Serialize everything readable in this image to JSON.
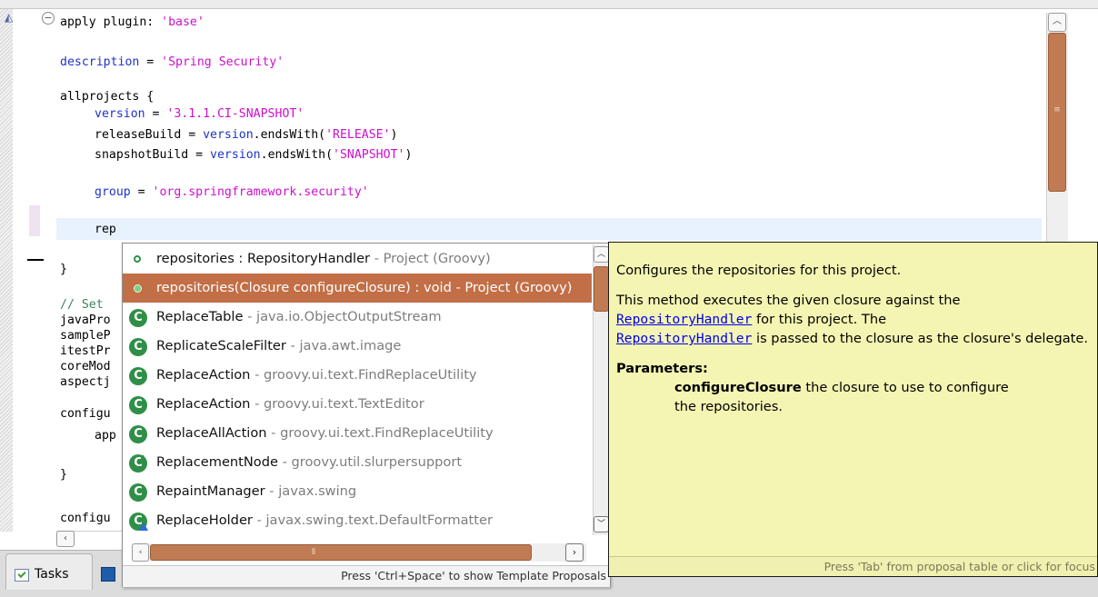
{
  "editor": {
    "code_lines": [
      {
        "id": "l1",
        "text": "apply plugin: 'base'"
      },
      {
        "id": "l2",
        "text": "description = 'Spring Security'"
      },
      {
        "id": "l3",
        "text": "allprojects {"
      },
      {
        "id": "l4",
        "text": "    version = '3.1.1.CI-SNAPSHOT'"
      },
      {
        "id": "l5",
        "text": "    releaseBuild = version.endsWith('RELEASE')"
      },
      {
        "id": "l6",
        "text": "    snapshotBuild = version.endsWith('SNAPSHOT')"
      },
      {
        "id": "l7",
        "text": "    group = 'org.springframework.security'"
      },
      {
        "id": "l8",
        "text": "    rep"
      },
      {
        "id": "l9",
        "text": "}"
      },
      {
        "id": "l10",
        "text": "// Set"
      },
      {
        "id": "l11",
        "text": "javaPro"
      },
      {
        "id": "l12",
        "text": "sampleP"
      },
      {
        "id": "l13",
        "text": "itestPr"
      },
      {
        "id": "l14",
        "text": "coreMod"
      },
      {
        "id": "l15",
        "text": "aspectj"
      },
      {
        "id": "l16",
        "text": "configu"
      },
      {
        "id": "l17",
        "text": "    app"
      },
      {
        "id": "l18",
        "text": "}"
      },
      {
        "id": "l19",
        "text": "configu"
      }
    ],
    "tokens": {
      "apply": "apply plugin: ",
      "apply_str": "'base'",
      "description_kw": "description",
      "description_eq": " = ",
      "description_str": "'Spring Security'",
      "allprojects": "allprojects {",
      "version_kw": "version",
      "version_str": "'3.1.1.CI-SNAPSHOT'",
      "release_prefix": "releaseBuild = ",
      "release_method": ".endsWith(",
      "release_str": "'RELEASE'",
      "snapshot_prefix": "snapshotBuild = ",
      "snapshot_str": "'SNAPSHOT'",
      "group_kw": "group",
      "group_str": "'org.springframework.security'",
      "rep": "rep",
      "close_brace": "}",
      "comment": "// Set",
      "javaPro": "javaPro",
      "sampleP": "sampleP",
      "itestPr": "itestPr",
      "coreMod": "coreMod",
      "aspectj": "aspectj",
      "configu": "configu",
      "app": "app",
      "configu2": "configu"
    }
  },
  "proposals": {
    "items": [
      {
        "name": "repositories : RepositoryHandler",
        "detail": " - Project (Groovy)",
        "icon": "field-icon",
        "selected": false
      },
      {
        "name": "repositories(Closure configureClosure) : void",
        "detail": " - Project (Groovy)",
        "icon": "method-icon",
        "selected": true
      },
      {
        "name": "ReplaceTable",
        "detail": " - java.io.ObjectOutputStream",
        "icon": "class-icon",
        "selected": false
      },
      {
        "name": "ReplicateScaleFilter",
        "detail": " - java.awt.image",
        "icon": "class-icon",
        "selected": false
      },
      {
        "name": "ReplaceAction",
        "detail": " - groovy.ui.text.FindReplaceUtility",
        "icon": "class-icon",
        "selected": false
      },
      {
        "name": "ReplaceAction",
        "detail": " - groovy.ui.text.TextEditor",
        "icon": "class-icon",
        "selected": false
      },
      {
        "name": "ReplaceAllAction",
        "detail": " - groovy.ui.text.FindReplaceUtility",
        "icon": "class-icon",
        "selected": false
      },
      {
        "name": "ReplacementNode",
        "detail": " - groovy.util.slurpersupport",
        "icon": "abstract-class-icon",
        "selected": false
      },
      {
        "name": "RepaintManager",
        "detail": " - javax.swing",
        "icon": "class-icon",
        "selected": false
      },
      {
        "name": "ReplaceHolder",
        "detail": " - javax.swing.text.DefaultFormatter",
        "icon": "class-icon",
        "selected": false
      }
    ],
    "status": "Press 'Ctrl+Space' to show Template Proposals"
  },
  "docs": {
    "summary": "Configures the repositories for this project.",
    "body_pre": "This method executes the given closure against the",
    "link1": "RepositoryHandler",
    "body_mid": " for this project. The",
    "link2": "RepositoryHandler",
    "body_post": " is passed to the closure as the closure's delegate.",
    "params_title": "Parameters:",
    "param_name": "configureClosure",
    "param_desc": " the closure to use to configure",
    "param_desc_cont": "the repositories.",
    "status": "Press 'Tab' from proposal table or click for focus"
  },
  "bottom_tabs": {
    "tasks_label": "Tasks"
  },
  "colors": {
    "keyword": "#1f33c9",
    "string": "#cc10cc",
    "selection": "#c26f47",
    "scroll_thumb": "#c07b52",
    "doc_background": "#f5f5b3"
  }
}
